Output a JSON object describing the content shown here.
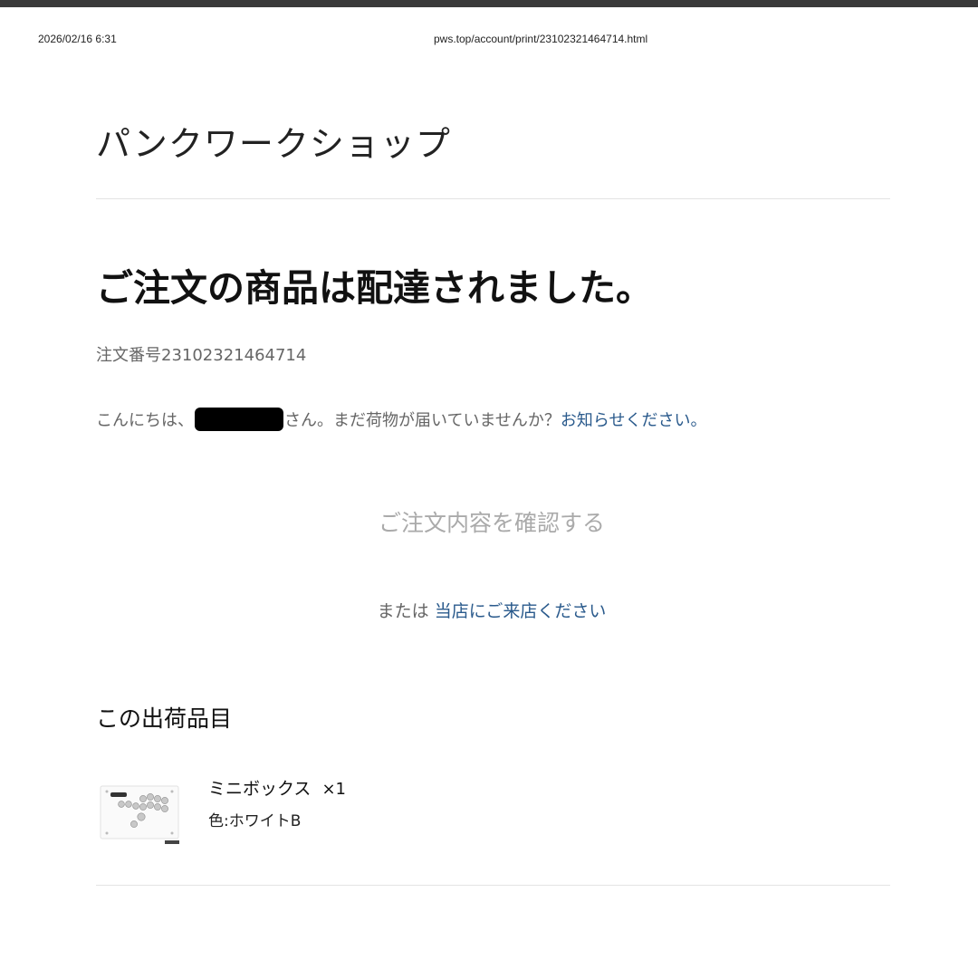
{
  "print_header": {
    "datetime": "2026/02/16 6:31",
    "url": "pws.top/account/print/23102321464714.html"
  },
  "shop": {
    "name": "パンクワークショップ"
  },
  "notice": {
    "heading": "ご注文の商品は配達されました。",
    "order_number_label": "注文番号",
    "order_number": "23102321464714",
    "greeting_prefix": "こんにちは、",
    "greeting_suffix": "さん。まだ荷物が届いていませんか？",
    "notify_link": "お知らせください。"
  },
  "actions": {
    "review_order": "ご注文内容を確認する",
    "or_text": "または",
    "visit_store": "当店にご来店ください"
  },
  "shipment": {
    "heading": "この出荷品目",
    "items": [
      {
        "name": "ミニボックス",
        "quantity": "×1",
        "variant_label": "色:",
        "variant_value": "ホワイトB",
        "image": "hitbox-controller-white"
      }
    ]
  },
  "colors": {
    "link": "#2a5a8c",
    "muted_text": "#666666",
    "button_text": "#aaaaaa"
  }
}
